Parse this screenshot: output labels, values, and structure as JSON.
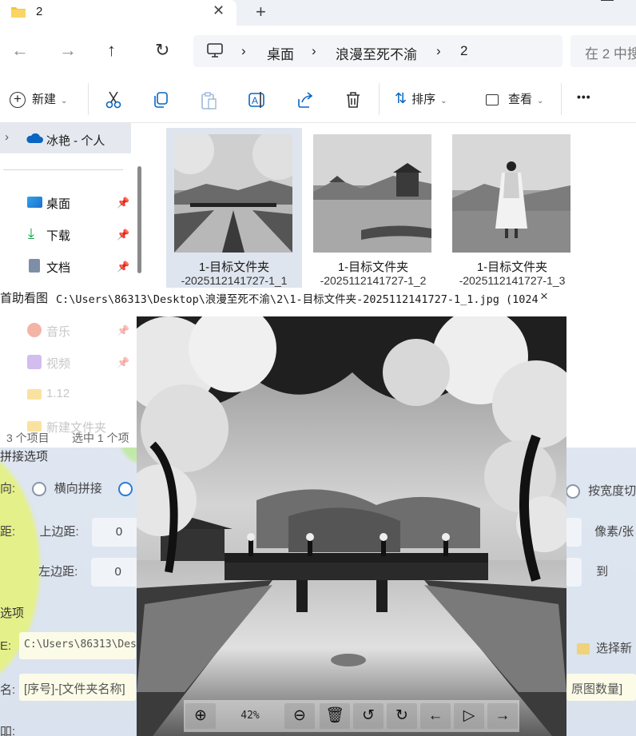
{
  "explorer": {
    "tab_title": "2",
    "breadcrumb": [
      "桌面",
      "浪漫至死不渝",
      "2"
    ],
    "search_placeholder": "在 2 中搜",
    "toolbar": {
      "new_label": "新建",
      "sort_label": "排序",
      "view_label": "查看",
      "more_label": "•••"
    },
    "nav": {
      "cloud_item": "冰艳 - 个人",
      "items": [
        {
          "label": "桌面",
          "icon": "desktop-icon"
        },
        {
          "label": "下载",
          "icon": "download-icon"
        },
        {
          "label": "文档",
          "icon": "document-icon"
        },
        {
          "label": "音乐",
          "icon": "music-icon"
        },
        {
          "label": "视频",
          "icon": "video-icon"
        },
        {
          "label": "1.12",
          "icon": "folder-icon"
        },
        {
          "label": "新建文件夹",
          "icon": "folder-icon"
        }
      ]
    },
    "files": [
      {
        "name": "1-目标文件夹",
        "sub": "-2025112141727-1_1"
      },
      {
        "name": "1-目标文件夹",
        "sub": "-2025112141727-1_2"
      },
      {
        "name": "1-目标文件夹",
        "sub": "-2025112141727-1_3"
      }
    ],
    "status": {
      "count": "3 个项目",
      "selected": "选中 1 个项"
    }
  },
  "viewer": {
    "title": "首助看图",
    "path": "C:\\Users\\86313\\Desktop\\浪漫至死不渝\\2\\1-目标文件夹-2025112141727-1_1.jpg (1024",
    "close": "×",
    "zoom": "42%"
  },
  "background_app": {
    "options_header": "拼接选项",
    "direction_label": "向:",
    "horizontal": "横向拼接",
    "by_width": "按宽度切",
    "margin_label": "距:",
    "top_margin": "上边距:",
    "top_value": "0",
    "left_margin": "左边距:",
    "left_value": "0",
    "unit": "像素/张",
    "to_label": "到",
    "output_header": "选项",
    "path_prefix": "E:",
    "path_value": "C:\\Users\\86313\\Desk",
    "choose_new": "选择新",
    "name_prefix": "名:",
    "name_pattern": "[序号]-[文件夹名称]",
    "count_pattern": "原图数量]",
    "last_label": "吅:"
  },
  "colors": {
    "accent": "#0a66c2",
    "selection": "#e5e9ef",
    "viewer_bg": "#111111"
  }
}
